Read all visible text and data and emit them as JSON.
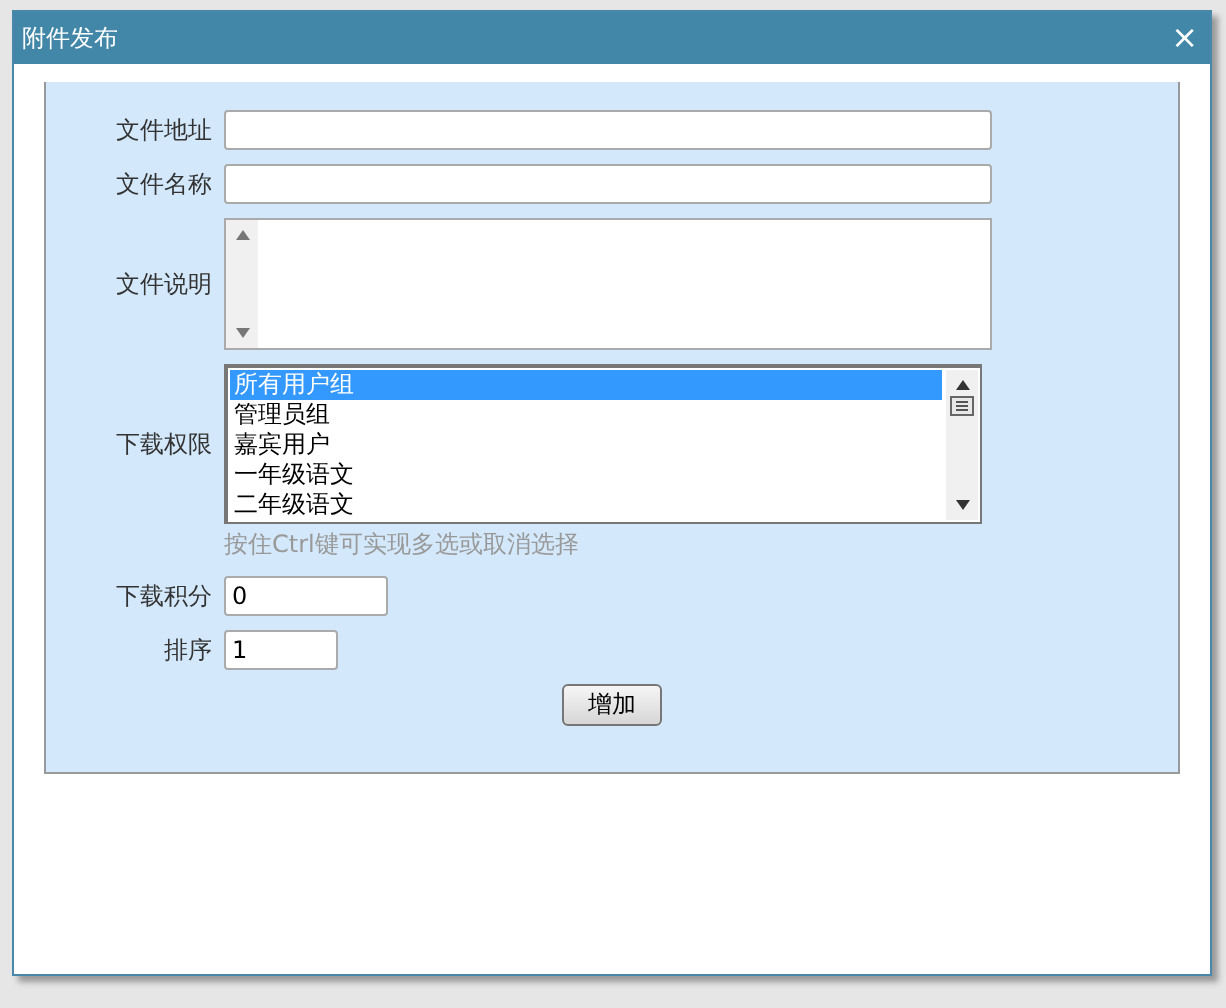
{
  "dialog": {
    "title": "附件发布",
    "close": "×"
  },
  "form": {
    "file_url": {
      "label": "文件地址"
    },
    "file_name": {
      "label": "文件名称"
    },
    "description": {
      "label": "文件说明"
    },
    "permission": {
      "label": "下载权限",
      "options": [
        {
          "label": "所有用户组",
          "selected": true
        },
        {
          "label": "管理员组",
          "selected": false
        },
        {
          "label": "嘉宾用户",
          "selected": false
        },
        {
          "label": "一年级语文",
          "selected": false
        },
        {
          "label": "二年级语文",
          "selected": false
        }
      ],
      "hint": "按住Ctrl键可实现多选或取消选择"
    },
    "points": {
      "label": "下载积分",
      "value": "0"
    },
    "order": {
      "label": "排序",
      "value": "1"
    },
    "submit": "增加"
  }
}
